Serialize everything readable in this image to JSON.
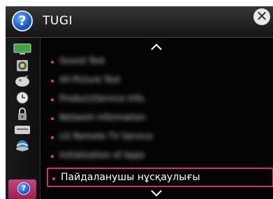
{
  "header": {
    "title": "TUGI"
  },
  "sidebar": {
    "items": [
      {
        "icon": "picture-icon"
      },
      {
        "icon": "sound-icon"
      },
      {
        "icon": "channel-icon"
      },
      {
        "icon": "time-icon"
      },
      {
        "icon": "lock-icon"
      },
      {
        "icon": "option-icon"
      },
      {
        "icon": "network-icon"
      },
      {
        "icon": "help-icon",
        "selected": true
      }
    ]
  },
  "list": {
    "items": [
      {
        "text": "Sound Test"
      },
      {
        "text": "All Picture Test"
      },
      {
        "text": "Product/Service Info."
      },
      {
        "text": "Network Information"
      },
      {
        "text": "LG Remote TV Service"
      },
      {
        "text": "Initialization of Apps"
      },
      {
        "text": "Пайдаланушы нұсқаулығы",
        "selected": true
      }
    ]
  }
}
